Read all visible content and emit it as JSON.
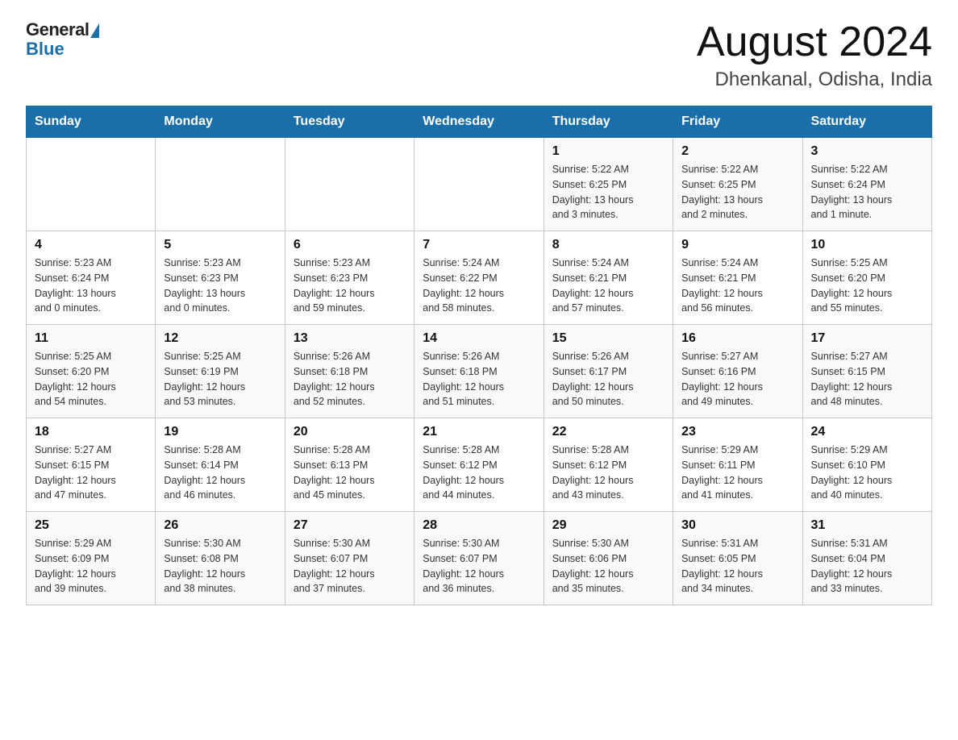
{
  "header": {
    "logo_general": "General",
    "logo_blue": "Blue",
    "month_year": "August 2024",
    "location": "Dhenkanal, Odisha, India"
  },
  "weekdays": [
    "Sunday",
    "Monday",
    "Tuesday",
    "Wednesday",
    "Thursday",
    "Friday",
    "Saturday"
  ],
  "weeks": [
    [
      {
        "day": "",
        "info": ""
      },
      {
        "day": "",
        "info": ""
      },
      {
        "day": "",
        "info": ""
      },
      {
        "day": "",
        "info": ""
      },
      {
        "day": "1",
        "info": "Sunrise: 5:22 AM\nSunset: 6:25 PM\nDaylight: 13 hours\nand 3 minutes."
      },
      {
        "day": "2",
        "info": "Sunrise: 5:22 AM\nSunset: 6:25 PM\nDaylight: 13 hours\nand 2 minutes."
      },
      {
        "day": "3",
        "info": "Sunrise: 5:22 AM\nSunset: 6:24 PM\nDaylight: 13 hours\nand 1 minute."
      }
    ],
    [
      {
        "day": "4",
        "info": "Sunrise: 5:23 AM\nSunset: 6:24 PM\nDaylight: 13 hours\nand 0 minutes."
      },
      {
        "day": "5",
        "info": "Sunrise: 5:23 AM\nSunset: 6:23 PM\nDaylight: 13 hours\nand 0 minutes."
      },
      {
        "day": "6",
        "info": "Sunrise: 5:23 AM\nSunset: 6:23 PM\nDaylight: 12 hours\nand 59 minutes."
      },
      {
        "day": "7",
        "info": "Sunrise: 5:24 AM\nSunset: 6:22 PM\nDaylight: 12 hours\nand 58 minutes."
      },
      {
        "day": "8",
        "info": "Sunrise: 5:24 AM\nSunset: 6:21 PM\nDaylight: 12 hours\nand 57 minutes."
      },
      {
        "day": "9",
        "info": "Sunrise: 5:24 AM\nSunset: 6:21 PM\nDaylight: 12 hours\nand 56 minutes."
      },
      {
        "day": "10",
        "info": "Sunrise: 5:25 AM\nSunset: 6:20 PM\nDaylight: 12 hours\nand 55 minutes."
      }
    ],
    [
      {
        "day": "11",
        "info": "Sunrise: 5:25 AM\nSunset: 6:20 PM\nDaylight: 12 hours\nand 54 minutes."
      },
      {
        "day": "12",
        "info": "Sunrise: 5:25 AM\nSunset: 6:19 PM\nDaylight: 12 hours\nand 53 minutes."
      },
      {
        "day": "13",
        "info": "Sunrise: 5:26 AM\nSunset: 6:18 PM\nDaylight: 12 hours\nand 52 minutes."
      },
      {
        "day": "14",
        "info": "Sunrise: 5:26 AM\nSunset: 6:18 PM\nDaylight: 12 hours\nand 51 minutes."
      },
      {
        "day": "15",
        "info": "Sunrise: 5:26 AM\nSunset: 6:17 PM\nDaylight: 12 hours\nand 50 minutes."
      },
      {
        "day": "16",
        "info": "Sunrise: 5:27 AM\nSunset: 6:16 PM\nDaylight: 12 hours\nand 49 minutes."
      },
      {
        "day": "17",
        "info": "Sunrise: 5:27 AM\nSunset: 6:15 PM\nDaylight: 12 hours\nand 48 minutes."
      }
    ],
    [
      {
        "day": "18",
        "info": "Sunrise: 5:27 AM\nSunset: 6:15 PM\nDaylight: 12 hours\nand 47 minutes."
      },
      {
        "day": "19",
        "info": "Sunrise: 5:28 AM\nSunset: 6:14 PM\nDaylight: 12 hours\nand 46 minutes."
      },
      {
        "day": "20",
        "info": "Sunrise: 5:28 AM\nSunset: 6:13 PM\nDaylight: 12 hours\nand 45 minutes."
      },
      {
        "day": "21",
        "info": "Sunrise: 5:28 AM\nSunset: 6:12 PM\nDaylight: 12 hours\nand 44 minutes."
      },
      {
        "day": "22",
        "info": "Sunrise: 5:28 AM\nSunset: 6:12 PM\nDaylight: 12 hours\nand 43 minutes."
      },
      {
        "day": "23",
        "info": "Sunrise: 5:29 AM\nSunset: 6:11 PM\nDaylight: 12 hours\nand 41 minutes."
      },
      {
        "day": "24",
        "info": "Sunrise: 5:29 AM\nSunset: 6:10 PM\nDaylight: 12 hours\nand 40 minutes."
      }
    ],
    [
      {
        "day": "25",
        "info": "Sunrise: 5:29 AM\nSunset: 6:09 PM\nDaylight: 12 hours\nand 39 minutes."
      },
      {
        "day": "26",
        "info": "Sunrise: 5:30 AM\nSunset: 6:08 PM\nDaylight: 12 hours\nand 38 minutes."
      },
      {
        "day": "27",
        "info": "Sunrise: 5:30 AM\nSunset: 6:07 PM\nDaylight: 12 hours\nand 37 minutes."
      },
      {
        "day": "28",
        "info": "Sunrise: 5:30 AM\nSunset: 6:07 PM\nDaylight: 12 hours\nand 36 minutes."
      },
      {
        "day": "29",
        "info": "Sunrise: 5:30 AM\nSunset: 6:06 PM\nDaylight: 12 hours\nand 35 minutes."
      },
      {
        "day": "30",
        "info": "Sunrise: 5:31 AM\nSunset: 6:05 PM\nDaylight: 12 hours\nand 34 minutes."
      },
      {
        "day": "31",
        "info": "Sunrise: 5:31 AM\nSunset: 6:04 PM\nDaylight: 12 hours\nand 33 minutes."
      }
    ]
  ]
}
